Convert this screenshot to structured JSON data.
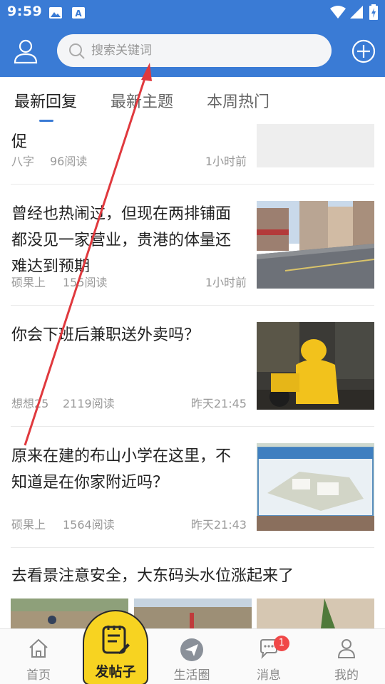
{
  "status_bar": {
    "time": "9:59",
    "left_icons": [
      "image-icon",
      "app-store-icon"
    ],
    "right_icons": [
      "wifi-icon",
      "signal-icon",
      "battery-icon"
    ]
  },
  "header": {
    "background_color": "#3a7bd5",
    "search": {
      "placeholder": "搜索关键词",
      "value": ""
    },
    "left_icon": "user-icon",
    "right_icon": "plus-circle-icon"
  },
  "tabs": [
    {
      "label": "最新回复",
      "active": true
    },
    {
      "label": "最新主题",
      "active": false
    },
    {
      "label": "本周热门",
      "active": false
    }
  ],
  "feed": [
    {
      "title": "那个年号已经被...，看家里是可\n促",
      "author": "八字",
      "reads": "96阅读",
      "time": "1小时前"
    },
    {
      "title": "曾经也热闹过，但现在两排铺面都没见一家营业，贵港的体量还难达到预期",
      "author": "硕果上",
      "reads": "155阅读",
      "time": "1小时前",
      "image": "street-photo"
    },
    {
      "title": "你会下班后兼职送外卖吗？",
      "author": "想想25",
      "reads": "2119阅读",
      "time": "昨天21:45",
      "image": "delivery-rider-photo"
    },
    {
      "title": "原来在建的布山小学在这里，不知道是在你家附近吗？",
      "author": "硕果上",
      "reads": "1564阅读",
      "time": "昨天21:43",
      "image": "school-billboard-photo"
    },
    {
      "title": "去看景注意安全，大东码头水位涨起来了",
      "images": [
        "flood-photo-1",
        "flood-photo-2",
        "flood-photo-3"
      ]
    }
  ],
  "bottom_nav": [
    {
      "label": "首页",
      "icon": "home-icon"
    },
    {
      "label": "发帖子",
      "icon": "compose-icon"
    },
    {
      "label": "生活圈",
      "icon": "paper-plane-icon"
    },
    {
      "label": "消息",
      "icon": "chat-icon",
      "badge": "1"
    },
    {
      "label": "我的",
      "icon": "profile-icon"
    }
  ],
  "colors": {
    "accent": "#3a7bd5",
    "post_button": "#f7d321",
    "badge": "#f04848",
    "annotation_arrow": "#e0393e"
  }
}
